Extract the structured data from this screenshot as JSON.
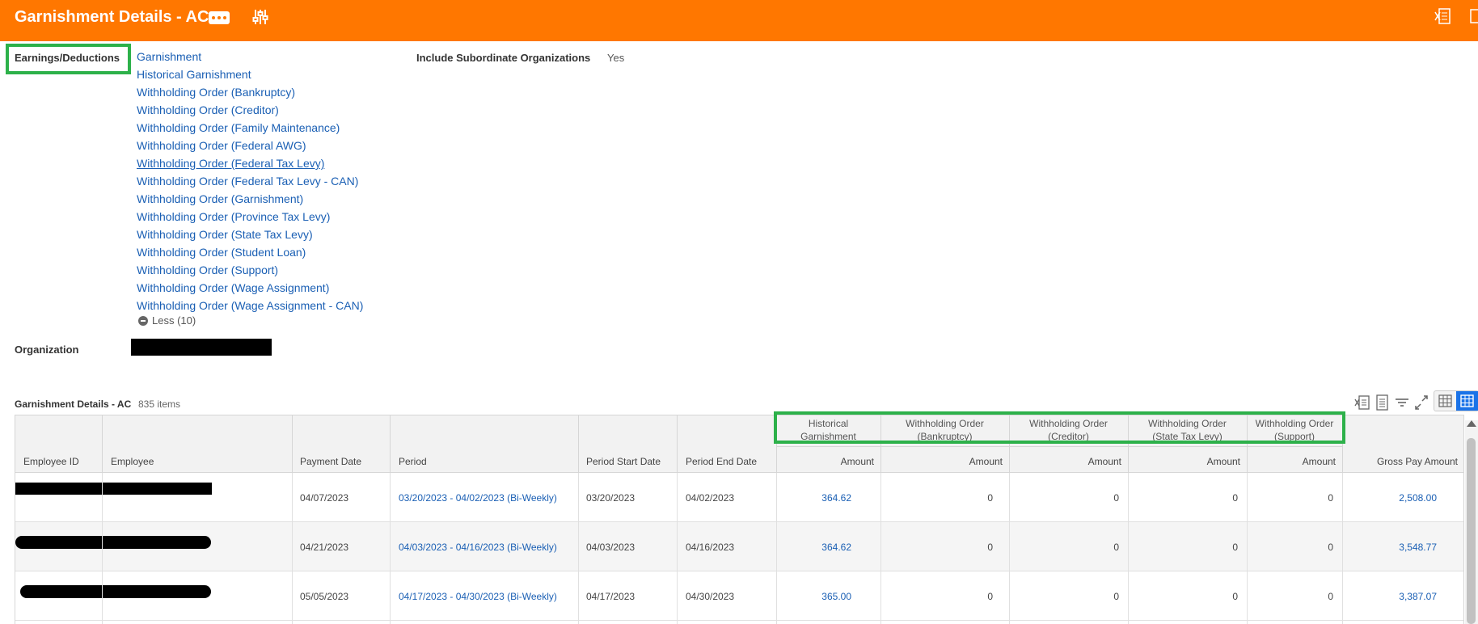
{
  "header": {
    "title": "Garnishment Details - AC",
    "icons": [
      "more-icon",
      "sliders-icon",
      "export-excel-icon"
    ]
  },
  "prompts": {
    "earnings_label": "Earnings/Deductions",
    "earnings_items": [
      "Garnishment",
      "Historical Garnishment",
      "Withholding Order (Bankruptcy)",
      "Withholding Order (Creditor)",
      "Withholding Order (Family Maintenance)",
      "Withholding Order (Federal AWG)",
      "Withholding Order (Federal Tax Levy)",
      "Withholding Order (Federal Tax Levy - CAN)",
      "Withholding Order (Garnishment)",
      "Withholding Order (Province Tax Levy)",
      "Withholding Order (State Tax Levy)",
      "Withholding Order (Student Loan)",
      "Withholding Order (Support)",
      "Withholding Order (Wage Assignment)",
      "Withholding Order (Wage Assignment - CAN)"
    ],
    "less_label": "Less (10)",
    "subordinate_label": "Include Subordinate Organizations",
    "subordinate_value": "Yes",
    "organization_label": "Organization"
  },
  "grid": {
    "title": "Garnishment Details - AC",
    "count": "835 items",
    "groups": [
      {
        "line1": "Historical",
        "line2": "Garnishment"
      },
      {
        "line1": "Withholding Order",
        "line2": "(Bankruptcy)"
      },
      {
        "line1": "Withholding Order",
        "line2": "(Creditor)"
      },
      {
        "line1": "Withholding Order",
        "line2": "(State Tax Levy)"
      },
      {
        "line1": "Withholding Order",
        "line2": "(Support)"
      }
    ],
    "columns": {
      "employee_id": "Employee ID",
      "employee": "Employee",
      "payment_date": "Payment Date",
      "period": "Period",
      "period_start": "Period Start Date",
      "period_end": "Period End Date",
      "amount": "Amount",
      "gross": "Gross Pay Amount"
    },
    "rows": [
      {
        "payment_date": "04/07/2023",
        "period": "03/20/2023 - 04/02/2023 (Bi-Weekly)",
        "start": "03/20/2023",
        "end": "04/02/2023",
        "hist": "364.62",
        "bankruptcy": "0",
        "creditor": "0",
        "state_tax": "0",
        "support": "0",
        "gross": "2,508.00"
      },
      {
        "payment_date": "04/21/2023",
        "period": "04/03/2023 - 04/16/2023 (Bi-Weekly)",
        "start": "04/03/2023",
        "end": "04/16/2023",
        "hist": "364.62",
        "bankruptcy": "0",
        "creditor": "0",
        "state_tax": "0",
        "support": "0",
        "gross": "3,548.77"
      },
      {
        "payment_date": "05/05/2023",
        "period": "04/17/2023 - 04/30/2023 (Bi-Weekly)",
        "start": "04/17/2023",
        "end": "04/30/2023",
        "hist": "365.00",
        "bankruptcy": "0",
        "creditor": "0",
        "state_tax": "0",
        "support": "0",
        "gross": "3,387.07"
      }
    ]
  },
  "colors": {
    "header_bg": "#ff7700",
    "link": "#1a5fb4",
    "highlight": "#2db14a"
  }
}
